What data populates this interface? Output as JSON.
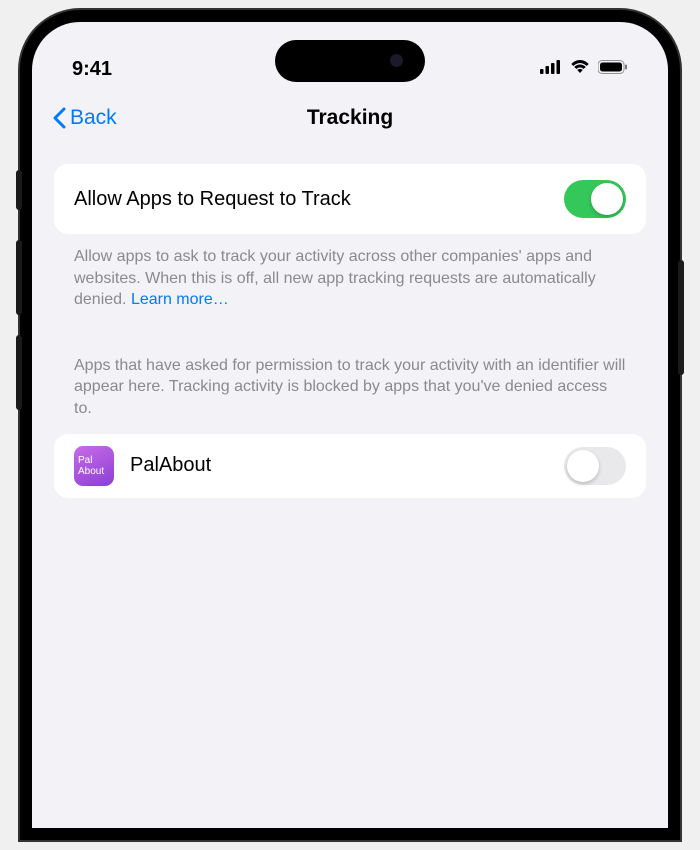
{
  "statusBar": {
    "time": "9:41"
  },
  "nav": {
    "backLabel": "Back",
    "title": "Tracking"
  },
  "allowSection": {
    "label": "Allow Apps to Request to Track",
    "toggleOn": true,
    "footer": "Allow apps to ask to track your activity across other companies' apps and websites. When this is off, all new app tracking requests are automatically denied. ",
    "learnMore": "Learn more…"
  },
  "appsSection": {
    "header": "Apps that have asked for permission to track your activity with an identifier will appear here. Tracking activity is blocked by apps that you've denied access to.",
    "apps": [
      {
        "name": "PalAbout",
        "iconLine1": "Pal",
        "iconLine2": "About",
        "toggleOn": false
      }
    ]
  }
}
